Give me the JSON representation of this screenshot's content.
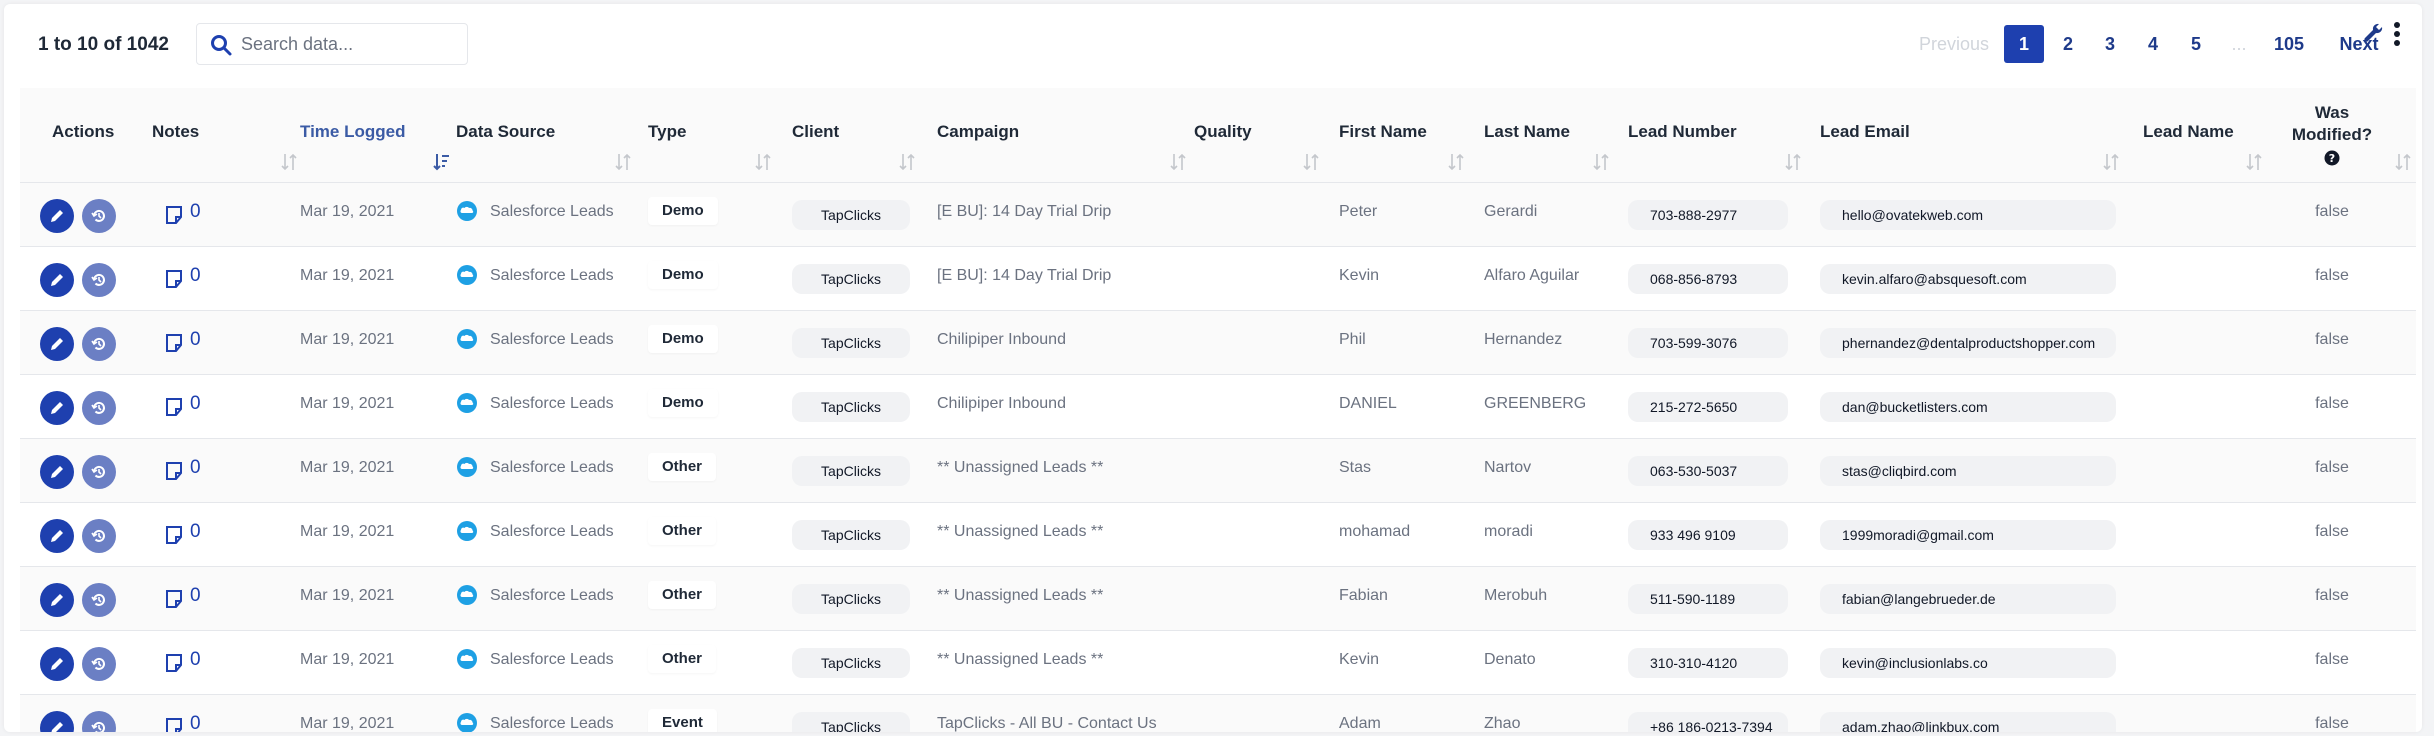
{
  "toolbar": {
    "range_text": "1 to 10 of 1042",
    "search_placeholder": "Search data...",
    "pagination": {
      "previous": "Previous",
      "pages": [
        "1",
        "2",
        "3",
        "4",
        "5",
        "...",
        "105"
      ],
      "active": "1",
      "next": "Next"
    }
  },
  "columns": {
    "actions": "Actions",
    "notes": "Notes",
    "time_logged": "Time Logged",
    "data_source": "Data Source",
    "type": "Type",
    "client": "Client",
    "campaign": "Campaign",
    "quality": "Quality",
    "first_name": "First Name",
    "last_name": "Last Name",
    "lead_number": "Lead Number",
    "lead_email": "Lead Email",
    "lead_name": "Lead Name",
    "was_modified_line1": "Was",
    "was_modified_line2": "Modified?"
  },
  "rows": [
    {
      "notes": "0",
      "time": "Mar 19, 2021",
      "source": "Salesforce Leads",
      "type": "Demo",
      "client": "TapClicks",
      "campaign": "[E BU]: 14 Day Trial Drip",
      "quality": "",
      "first": "Peter",
      "last": "Gerardi",
      "number": "703-888-2977",
      "email": "hello@ovatekweb.com",
      "lead_name": "",
      "modified": "false"
    },
    {
      "notes": "0",
      "time": "Mar 19, 2021",
      "source": "Salesforce Leads",
      "type": "Demo",
      "client": "TapClicks",
      "campaign": "[E BU]: 14 Day Trial Drip",
      "quality": "",
      "first": "Kevin",
      "last": "Alfaro Aguilar",
      "number": "068-856-8793",
      "email": "kevin.alfaro@absquesoft.com",
      "lead_name": "",
      "modified": "false"
    },
    {
      "notes": "0",
      "time": "Mar 19, 2021",
      "source": "Salesforce Leads",
      "type": "Demo",
      "client": "TapClicks",
      "campaign": "Chilipiper Inbound",
      "quality": "",
      "first": "Phil",
      "last": "Hernandez",
      "number": "703-599-3076",
      "email": "phernandez@dentalproductshopper.com",
      "lead_name": "",
      "modified": "false"
    },
    {
      "notes": "0",
      "time": "Mar 19, 2021",
      "source": "Salesforce Leads",
      "type": "Demo",
      "client": "TapClicks",
      "campaign": "Chilipiper Inbound",
      "quality": "",
      "first": "DANIEL",
      "last": "GREENBERG",
      "number": "215-272-5650",
      "email": "dan@bucketlisters.com",
      "lead_name": "",
      "modified": "false"
    },
    {
      "notes": "0",
      "time": "Mar 19, 2021",
      "source": "Salesforce Leads",
      "type": "Other",
      "client": "TapClicks",
      "campaign": "** Unassigned Leads **",
      "quality": "",
      "first": "Stas",
      "last": "Nartov",
      "number": "063-530-5037",
      "email": "stas@cliqbird.com",
      "lead_name": "",
      "modified": "false"
    },
    {
      "notes": "0",
      "time": "Mar 19, 2021",
      "source": "Salesforce Leads",
      "type": "Other",
      "client": "TapClicks",
      "campaign": "** Unassigned Leads **",
      "quality": "",
      "first": "mohamad",
      "last": "moradi",
      "number": "933 496 9109",
      "email": "1999moradi@gmail.com",
      "lead_name": "",
      "modified": "false"
    },
    {
      "notes": "0",
      "time": "Mar 19, 2021",
      "source": "Salesforce Leads",
      "type": "Other",
      "client": "TapClicks",
      "campaign": "** Unassigned Leads **",
      "quality": "",
      "first": "Fabian",
      "last": "Merobuh",
      "number": "511-590-1189",
      "email": "fabian@langebrueder.de",
      "lead_name": "",
      "modified": "false"
    },
    {
      "notes": "0",
      "time": "Mar 19, 2021",
      "source": "Salesforce Leads",
      "type": "Other",
      "client": "TapClicks",
      "campaign": "** Unassigned Leads **",
      "quality": "",
      "first": "Kevin",
      "last": "Denato",
      "number": "310-310-4120",
      "email": "kevin@inclusionlabs.co",
      "lead_name": "",
      "modified": "false"
    },
    {
      "notes": "0",
      "time": "Mar 19, 2021",
      "source": "Salesforce Leads",
      "type": "Event",
      "client": "TapClicks",
      "campaign": "TapClicks - All BU - Contact Us",
      "quality": "",
      "first": "Adam",
      "last": "Zhao",
      "number": "+86 186-0213-7394",
      "email": "adam.zhao@linkbux.com",
      "lead_name": "",
      "modified": "false"
    }
  ]
}
